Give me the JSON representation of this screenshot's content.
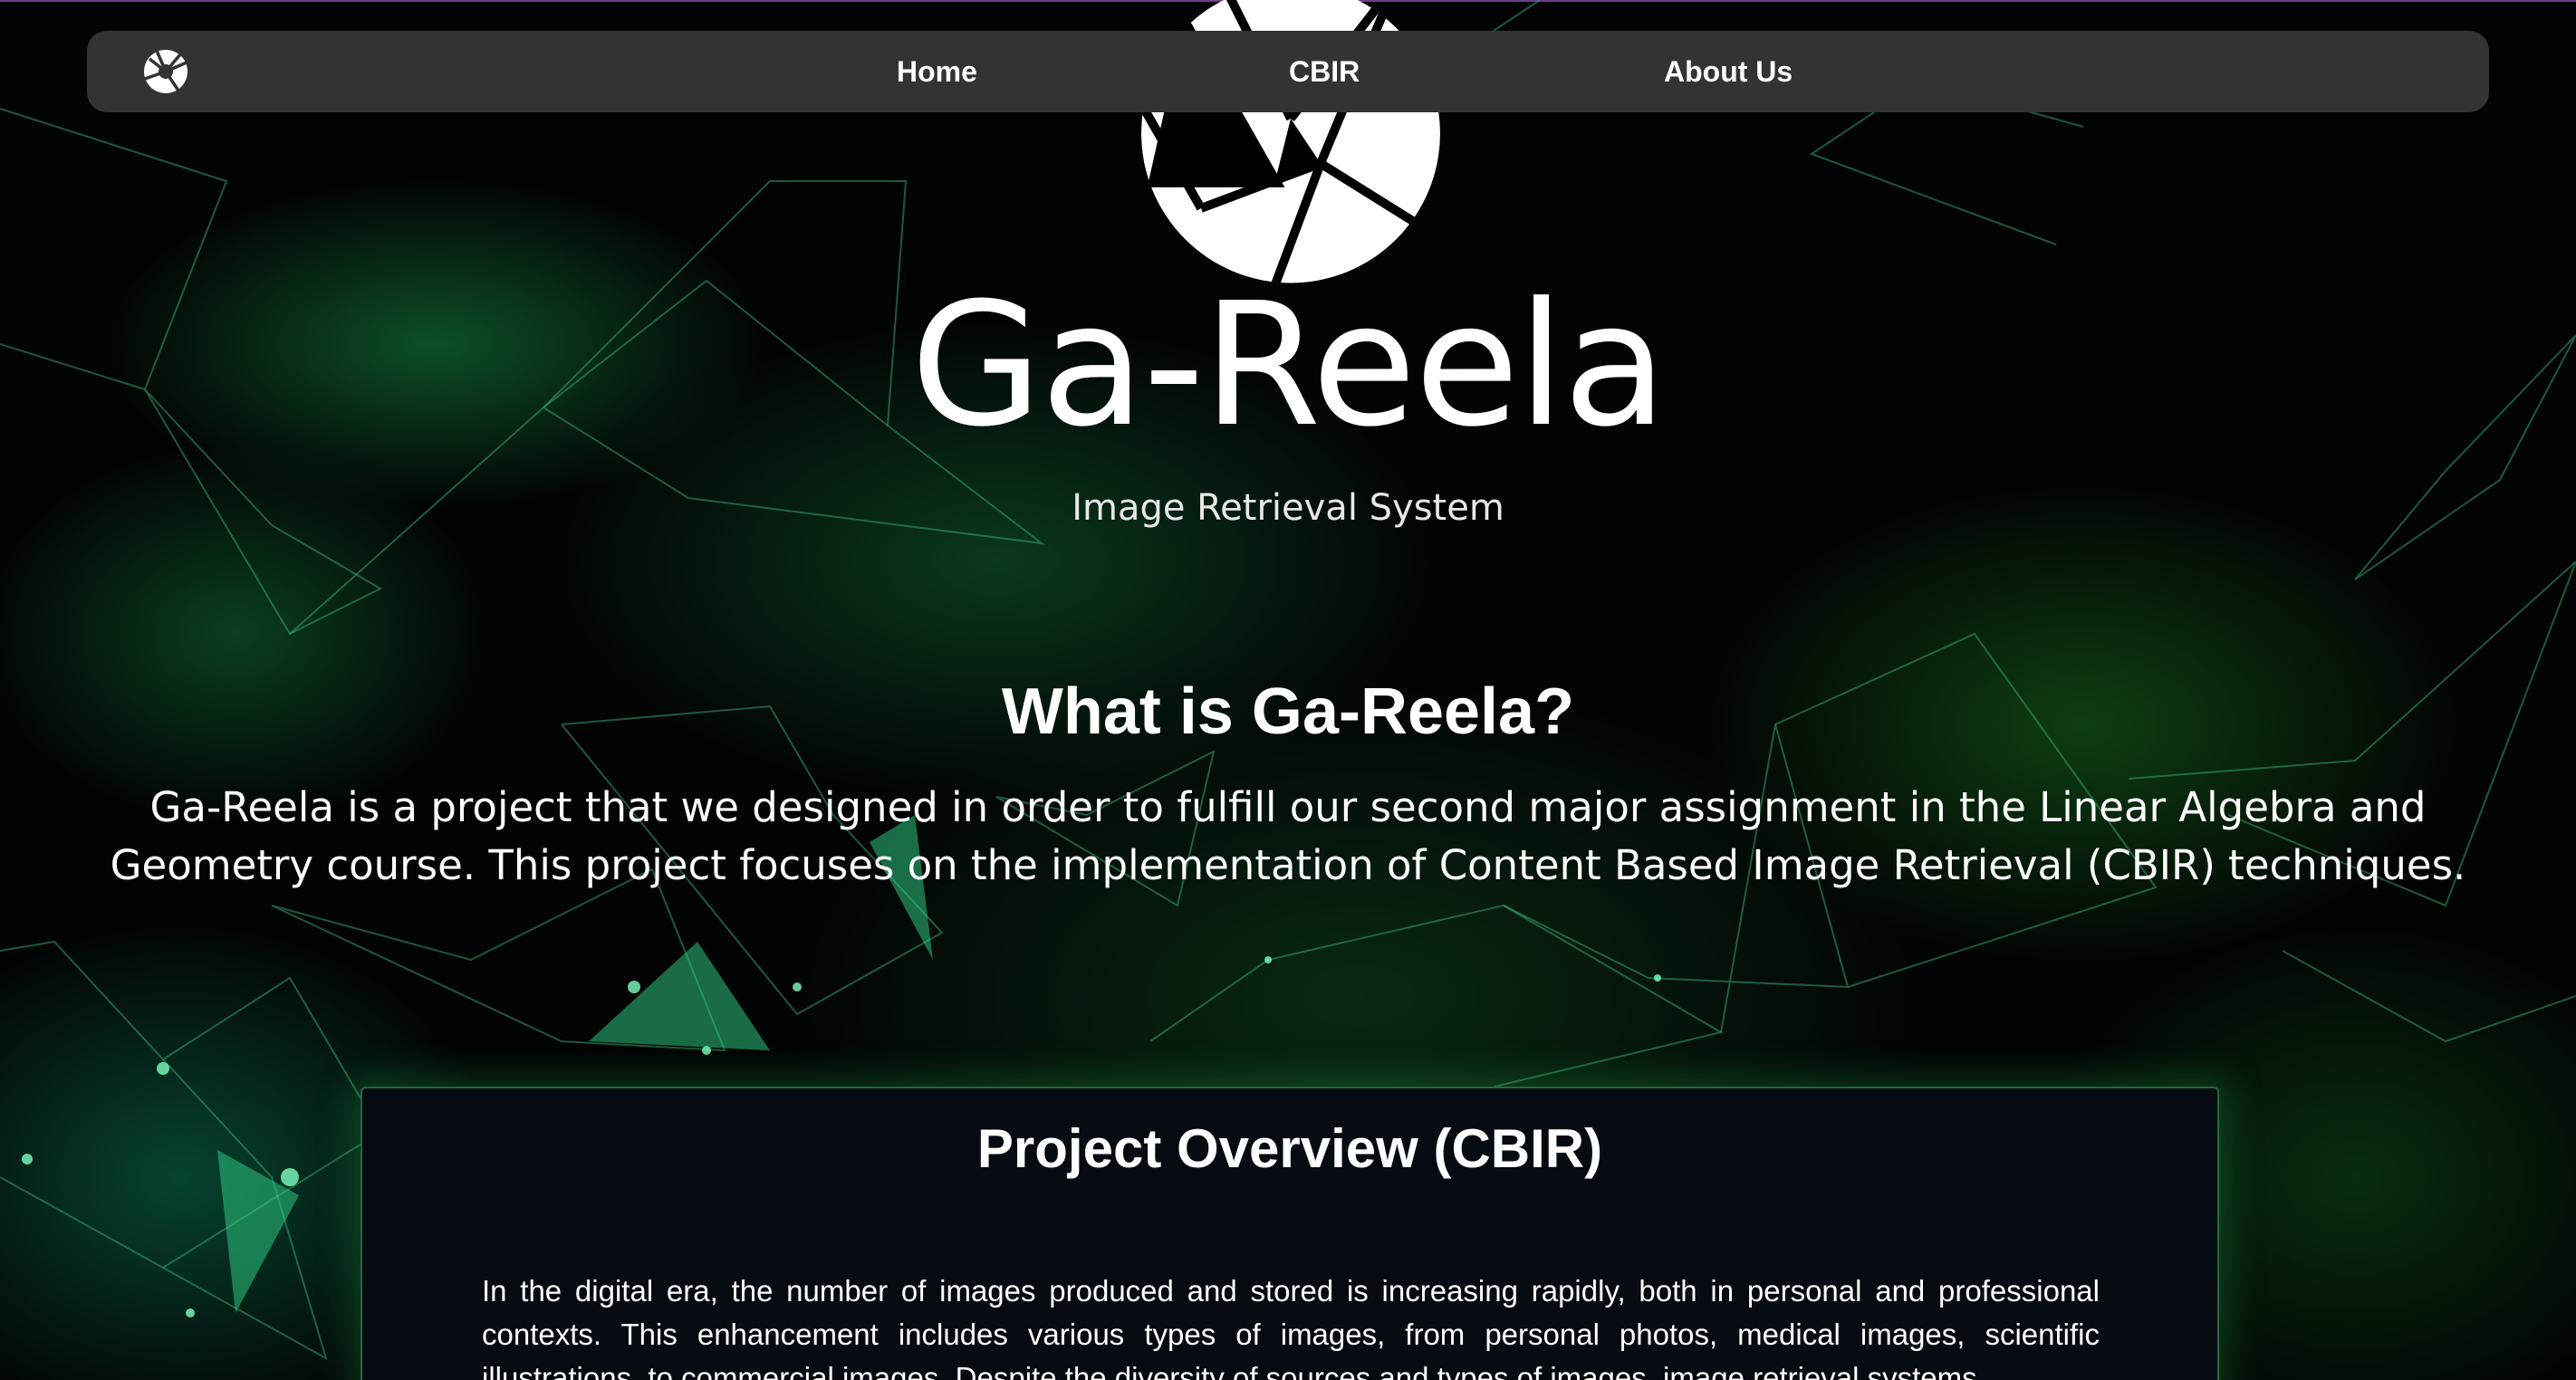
{
  "nav": {
    "logo_icon": "camera-aperture-icon",
    "items": [
      {
        "label": "Home"
      },
      {
        "label": "CBIR"
      },
      {
        "label": "About Us"
      }
    ]
  },
  "hero": {
    "logo_icon": "camera-aperture-icon",
    "title": "Ga-Reela",
    "subtitle": "Image Retrieval System"
  },
  "about": {
    "heading": "What is Ga-Reela?",
    "text": "Ga-Reela is a project that we designed in order to fulfill our second major assignment in the Linear Algebra and Geometry course. This project focuses on the implementation of Content Based Image Retrieval (CBIR) techniques."
  },
  "overview": {
    "heading": "Project Overview (CBIR)",
    "text": "In the digital era, the number of images produced and stored is increasing rapidly, both in personal and professional contexts. This enhancement includes various types of images, from personal photos, medical images, scientific illustrations, to commercial images. Despite the diversity of sources and types of images, image retrieval systems"
  },
  "colors": {
    "navbar_bg": "#333333",
    "accent_green": "#1f6b3e",
    "card_bg": "#050b10",
    "top_border": "#6b3f86"
  }
}
